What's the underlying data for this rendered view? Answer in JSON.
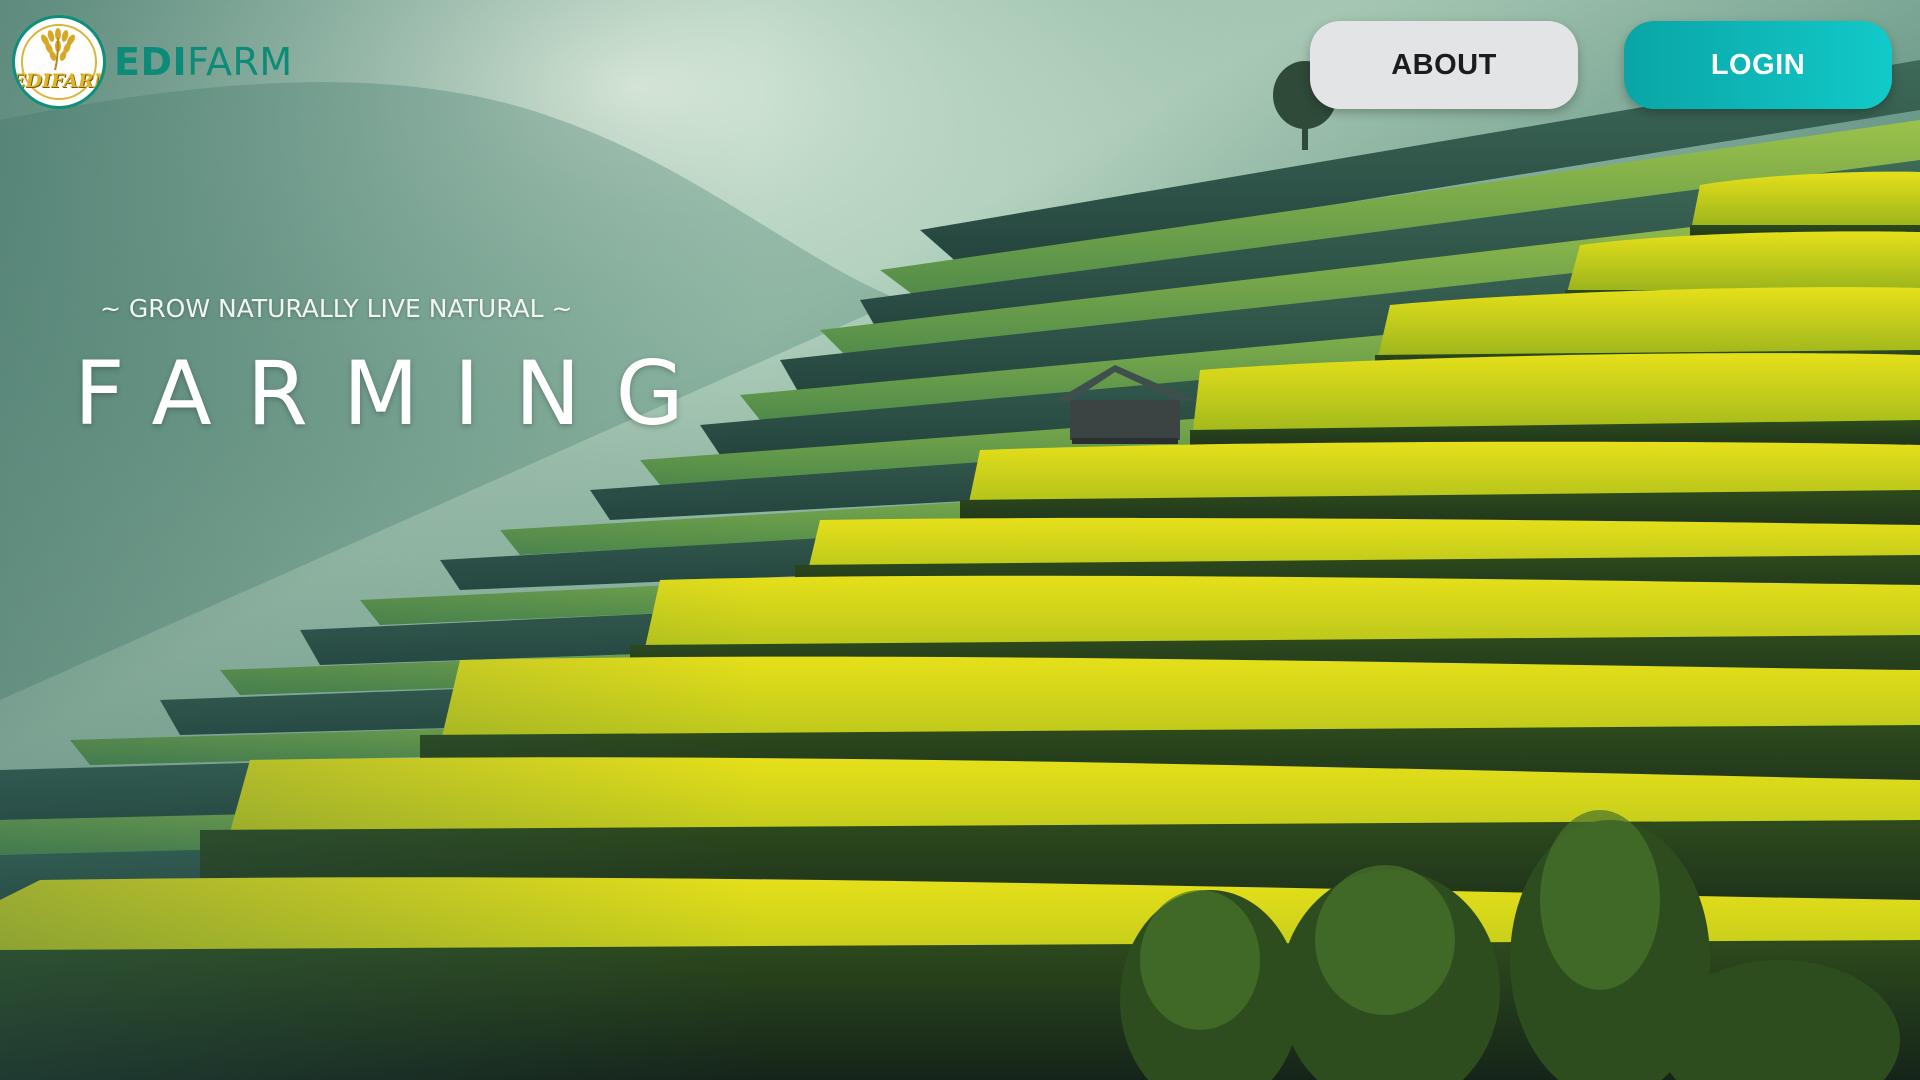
{
  "brand": {
    "logo_text": "EDIFARM",
    "name_bold": "EDI",
    "name_rest": "FARM"
  },
  "nav": {
    "about_label": "ABOUT",
    "login_label": "LOGIN"
  },
  "hero": {
    "tagline": "~ GROW NATURALLY LIVE NATURAL ~",
    "headline": "FARMING"
  },
  "colors": {
    "brand_teal": "#0e8b78",
    "login_gradient_start": "#0aa5a6",
    "login_gradient_end": "#12c9c9",
    "about_bg": "#e3e4e6",
    "terrace_yellow_green": "#c9d615"
  },
  "icons": {
    "logo": "rice-grain-logo-icon"
  }
}
